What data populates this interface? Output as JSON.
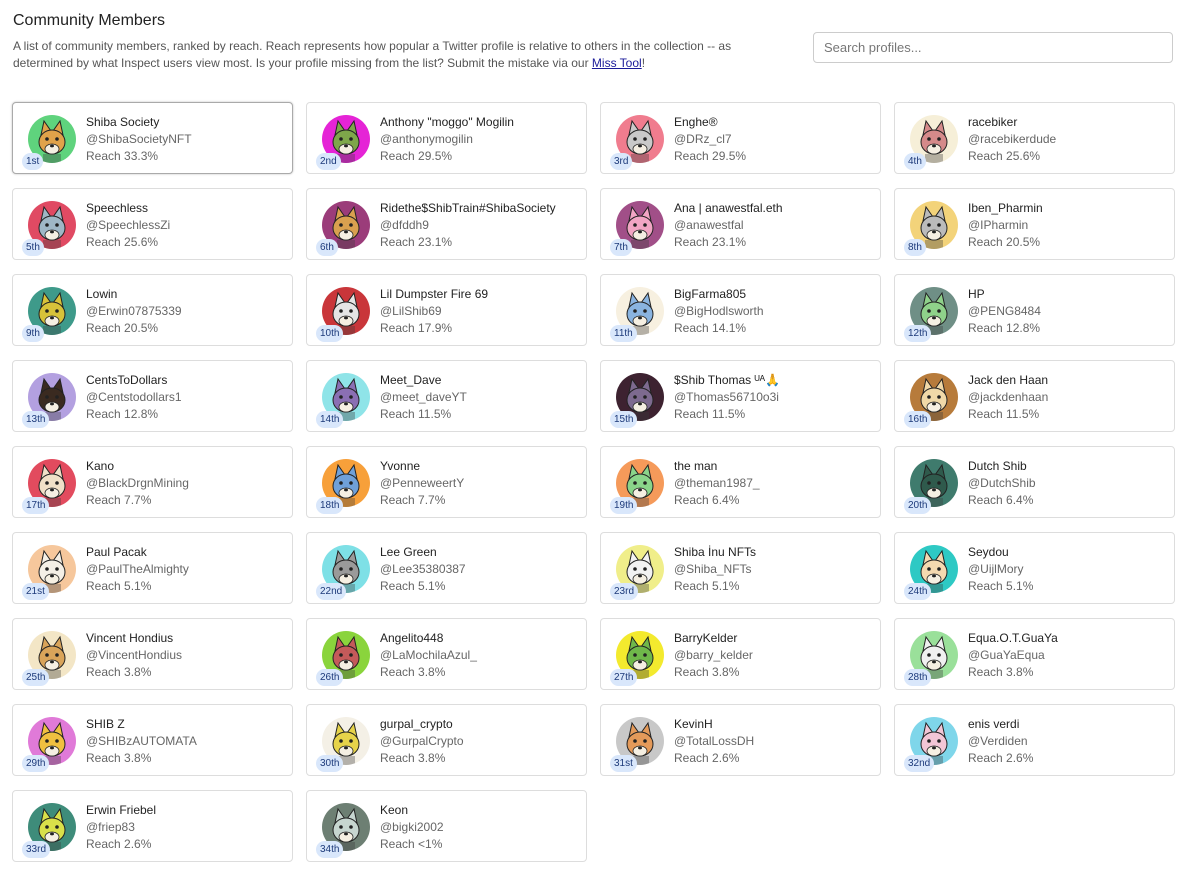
{
  "page": {
    "title": "Community Members",
    "description_text": "A list of community members, ranked by reach. Reach represents how popular a Twitter profile is relative to others in the collection -- as determined by what Inspect users view most. Is your profile missing from the list? Submit the mistake via our ",
    "description_link": "Miss Tool",
    "description_end": "!",
    "search_placeholder": "Search profiles..."
  },
  "members": [
    {
      "rank": "1st",
      "name": "Shiba Society",
      "handle": "@ShibaSocietyNFT",
      "reach": "Reach 33.3%",
      "bg": "#5fd37d",
      "fur": "#e0a24a"
    },
    {
      "rank": "2nd",
      "name": "Anthony \"moggo\" Mogilin",
      "handle": "@anthonymogilin",
      "reach": "Reach 29.5%",
      "bg": "#e524d6",
      "fur": "#7ea74a"
    },
    {
      "rank": "3rd",
      "name": "Enghe®",
      "handle": "@DRz_cl7",
      "reach": "Reach 29.5%",
      "bg": "#f07c8e",
      "fur": "#c9c9c9"
    },
    {
      "rank": "4th",
      "name": "racebiker",
      "handle": "@racebikerdude",
      "reach": "Reach 25.6%",
      "bg": "#f6efd8",
      "fur": "#d58a8a"
    },
    {
      "rank": "5th",
      "name": "Speechless",
      "handle": "@SpeechlessZi",
      "reach": "Reach 25.6%",
      "bg": "#e04a63",
      "fur": "#9fb7c6"
    },
    {
      "rank": "6th",
      "name": "Ridethe$ShibTrain#ShibaSociety",
      "handle": "@dfddh9",
      "reach": "Reach 23.1%",
      "bg": "#9b3c7a",
      "fur": "#d9a04f"
    },
    {
      "rank": "7th",
      "name": "Ana | anawestfal.eth",
      "handle": "@anawestfal",
      "reach": "Reach 23.1%",
      "bg": "#a14f88",
      "fur": "#f2a5c4"
    },
    {
      "rank": "8th",
      "name": "Iben_Pharmin",
      "handle": "@IPharmin",
      "reach": "Reach 20.5%",
      "bg": "#f3d37a",
      "fur": "#bbbbbb"
    },
    {
      "rank": "9th",
      "name": "Lowin",
      "handle": "@Erwin07875339",
      "reach": "Reach 20.5%",
      "bg": "#3e9a8a",
      "fur": "#d7c23a"
    },
    {
      "rank": "10th",
      "name": "Lil Dumpster Fire 69",
      "handle": "@LilShib69",
      "reach": "Reach 17.9%",
      "bg": "#c9363a",
      "fur": "#e5e5e5"
    },
    {
      "rank": "11th",
      "name": "BigFarma805",
      "handle": "@BigHodlsworth",
      "reach": "Reach 14.1%",
      "bg": "#f7f0e0",
      "fur": "#8ab4e0"
    },
    {
      "rank": "12th",
      "name": "HP",
      "handle": "@PENG8484",
      "reach": "Reach 12.8%",
      "bg": "#6f8f86",
      "fur": "#8fd18a"
    },
    {
      "rank": "13th",
      "name": "CentsToDollars",
      "handle": "@Centstodollars1",
      "reach": "Reach 12.8%",
      "bg": "#b3a0e0",
      "fur": "#3a2a20"
    },
    {
      "rank": "14th",
      "name": "Meet_Dave",
      "handle": "@meet_daveYT",
      "reach": "Reach 11.5%",
      "bg": "#8fe4e8",
      "fur": "#8a6fb3"
    },
    {
      "rank": "15th",
      "name": "$Shib Thomas ᵁᴬ🙏",
      "handle": "@Thomas56710o3i",
      "reach": "Reach 11.5%",
      "bg": "#3d2230",
      "fur": "#7d6a8f"
    },
    {
      "rank": "16th",
      "name": "Jack den Haan",
      "handle": "@jackdenhaan",
      "reach": "Reach 11.5%",
      "bg": "#b77b3b",
      "fur": "#f0d9a8"
    },
    {
      "rank": "17th",
      "name": "Kano",
      "handle": "@BlackDrgnMining",
      "reach": "Reach 7.7%",
      "bg": "#e24b5e",
      "fur": "#f0e0c8"
    },
    {
      "rank": "18th",
      "name": "Yvonne",
      "handle": "@PenneweertY",
      "reach": "Reach 7.7%",
      "bg": "#f7a03a",
      "fur": "#6fa0d8"
    },
    {
      "rank": "19th",
      "name": "the man",
      "handle": "@theman1987_",
      "reach": "Reach 6.4%",
      "bg": "#f59a5a",
      "fur": "#8ad48a"
    },
    {
      "rank": "20th",
      "name": "Dutch Shib",
      "handle": "@DutchShib",
      "reach": "Reach 6.4%",
      "bg": "#3f7b6d",
      "fur": "#2f5a4c"
    },
    {
      "rank": "21st",
      "name": "Paul Pacak",
      "handle": "@PaulTheAlmighty",
      "reach": "Reach 5.1%",
      "bg": "#f6c79c",
      "fur": "#f4efe6"
    },
    {
      "rank": "22nd",
      "name": "Lee Green",
      "handle": "@Lee35380387",
      "reach": "Reach 5.1%",
      "bg": "#7ee0e6",
      "fur": "#9a9a9a"
    },
    {
      "rank": "23rd",
      "name": "Shiba İnu NFTs",
      "handle": "@Shiba_NFTs",
      "reach": "Reach 5.1%",
      "bg": "#f0ee8a",
      "fur": "#f2f2f2"
    },
    {
      "rank": "24th",
      "name": "Seydou",
      "handle": "@UijlMory",
      "reach": "Reach 5.1%",
      "bg": "#2ec9c4",
      "fur": "#f4d9b0"
    },
    {
      "rank": "25th",
      "name": "Vincent Hondius",
      "handle": "@VincentHondius",
      "reach": "Reach 3.8%",
      "bg": "#f3e6c6",
      "fur": "#d9a45a"
    },
    {
      "rank": "26th",
      "name": "Angelito448",
      "handle": "@LaMochilaAzul_",
      "reach": "Reach 3.8%",
      "bg": "#8ad43c",
      "fur": "#c45a5a"
    },
    {
      "rank": "27th",
      "name": "BarryKelder",
      "handle": "@barry_kelder",
      "reach": "Reach 3.8%",
      "bg": "#f3ea2e",
      "fur": "#6fb84a"
    },
    {
      "rank": "28th",
      "name": "Equa.O.T.GuaYa",
      "handle": "@GuaYaEqua",
      "reach": "Reach 3.8%",
      "bg": "#9ae09a",
      "fur": "#f0f0f0"
    },
    {
      "rank": "29th",
      "name": "SHIB Z",
      "handle": "@SHIBzAUTOMATA",
      "reach": "Reach 3.8%",
      "bg": "#e07ad8",
      "fur": "#f0c040"
    },
    {
      "rank": "30th",
      "name": "gurpal_crypto",
      "handle": "@GurpalCrypto",
      "reach": "Reach 3.8%",
      "bg": "#f4f0e6",
      "fur": "#e6d34a"
    },
    {
      "rank": "31st",
      "name": "KevinH",
      "handle": "@TotalLossDH",
      "reach": "Reach 2.6%",
      "bg": "#c8c8c8",
      "fur": "#e49a5a"
    },
    {
      "rank": "32nd",
      "name": "enis verdi",
      "handle": "@Verdiden",
      "reach": "Reach 2.6%",
      "bg": "#7fd6ea",
      "fur": "#f2c6d6"
    },
    {
      "rank": "33rd",
      "name": "Erwin Friebel",
      "handle": "@friep83",
      "reach": "Reach 2.6%",
      "bg": "#3e8c7a",
      "fur": "#d9e04a"
    },
    {
      "rank": "34th",
      "name": "Keon",
      "handle": "@bigki2002",
      "reach": "Reach <1%",
      "bg": "#6d7f73",
      "fur": "#c7d6d0"
    }
  ]
}
